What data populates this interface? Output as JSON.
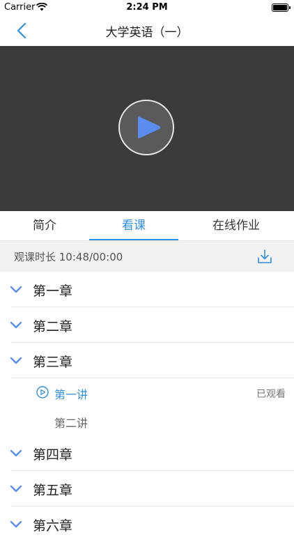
{
  "statusbar": {
    "carrier": "Carrier",
    "time": "2:24 PM"
  },
  "navbar": {
    "title": "大学英语（一）"
  },
  "tabs": [
    {
      "label": "简介"
    },
    {
      "label": "看课"
    },
    {
      "label": "在线作业"
    }
  ],
  "info": {
    "watch_time": "观课时长 10:48/00:00"
  },
  "chapters": [
    {
      "label": "第一章"
    },
    {
      "label": "第二章"
    },
    {
      "label": "第三章"
    },
    {
      "label": "第四章"
    },
    {
      "label": "第五章"
    },
    {
      "label": "第六章"
    }
  ],
  "lectures": [
    {
      "label": "第一讲",
      "status": "已观看"
    },
    {
      "label": "第二讲",
      "status": ""
    }
  ],
  "colors": {
    "accent": "#2f8fe0",
    "video_bg": "#3b3b3b",
    "play_icon": "#5b8def",
    "chevron": "#5b8def"
  }
}
